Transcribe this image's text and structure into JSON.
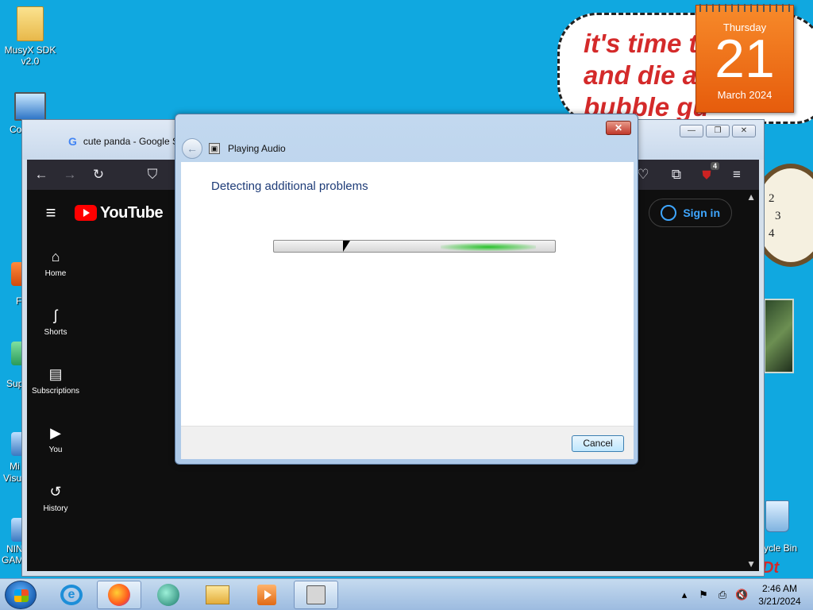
{
  "desktop": {
    "icons": [
      {
        "label": "MusyX SDK v2.0"
      },
      {
        "label": "Co"
      }
    ],
    "partial_labels": {
      "f": "F",
      "sup": "Sup",
      "mi": "Mi",
      "visu": "Visu",
      "nin": "NIN",
      "gam": "GAM",
      "recycle": "ycle Bin"
    },
    "bubble_text": "it's time t     hit\nand die a      w\nbubble gu",
    "calendar": {
      "day": "Thursday",
      "date": "21",
      "month_year": "March 2024"
    },
    "clock_numbers": [
      "2",
      "3",
      "4"
    ]
  },
  "browser": {
    "tab_title": "cute panda - Google S",
    "ublock_badge": "4",
    "window_buttons": {
      "minimize": "—",
      "maximize": "❐",
      "close": "✕"
    },
    "youtube": {
      "logo_text": "YouTube",
      "sign_in": "Sign in",
      "sidebar": [
        {
          "label": "Home",
          "icon": "⌂"
        },
        {
          "label": "Shorts",
          "icon": "ʃ"
        },
        {
          "label": "Subscriptions",
          "icon": "▤"
        },
        {
          "label": "You",
          "icon": "▶"
        },
        {
          "label": "History",
          "icon": "↺"
        }
      ]
    }
  },
  "dialog": {
    "title": "Playing Audio",
    "heading": "Detecting additional problems",
    "progress_state": "indeterminate",
    "cancel_label": "Cancel",
    "close_glyph": "✕",
    "back_glyph": "←"
  },
  "taskbar": {
    "time": "2:46 AM",
    "date": "3/21/2024",
    "tray_icons": [
      "▴",
      "⚑",
      "⎙",
      "🔇"
    ]
  },
  "colors": {
    "desktop_bg": "#10a8e0",
    "calendar_orange": "#f07a1c",
    "dialog_heading": "#1e3c78",
    "youtube_red": "#ff0000",
    "signin_blue": "#3ea6ff"
  }
}
